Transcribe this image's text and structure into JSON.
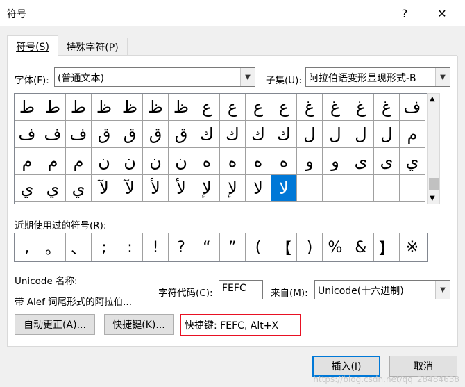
{
  "window": {
    "title": "符号",
    "help_label": "?",
    "close_label": "✕"
  },
  "tabs": [
    {
      "label": "符号(S)"
    },
    {
      "label": "特殊字符(P)"
    }
  ],
  "font": {
    "label": "字体(F):",
    "value": "(普通文本)"
  },
  "subset": {
    "label": "子集(U):",
    "value": "阿拉伯语变形显现形式-B"
  },
  "symbols": [
    [
      "ط",
      "ط",
      "ط",
      "ظ",
      "ظ",
      "ظ",
      "ظ",
      "ع",
      "ع",
      "ع",
      "ع",
      "غ",
      "غ",
      "غ",
      "غ",
      "ف"
    ],
    [
      "ف",
      "ف",
      "ف",
      "ق",
      "ق",
      "ق",
      "ق",
      "ك",
      "ك",
      "ك",
      "ك",
      "ل",
      "ل",
      "ل",
      "ل",
      "م"
    ],
    [
      "م",
      "م",
      "م",
      "ن",
      "ن",
      "ن",
      "ن",
      "ه",
      "ه",
      "ه",
      "ه",
      "و",
      "و",
      "ى",
      "ى",
      "ي"
    ],
    [
      "ي",
      "ي",
      "ي",
      "لآ",
      "لآ",
      "لأ",
      "لأ",
      "لإ",
      "لإ",
      "لا",
      "لا",
      "",
      "",
      "",
      "",
      ""
    ]
  ],
  "selected_index": {
    "row": 3,
    "col": 10
  },
  "recent": {
    "label": "近期使用过的符号(R):",
    "items": [
      ",",
      "。",
      "、",
      ";",
      ":",
      "!",
      "?",
      "“",
      "”",
      "(",
      "【",
      ")",
      "%",
      "&",
      "】",
      "※"
    ]
  },
  "unicode_name": {
    "label": "Unicode 名称:",
    "value": "带 Alef 词尾形式的阿拉伯..."
  },
  "char_code": {
    "label": "字符代码(C):",
    "value": "FEFC"
  },
  "from": {
    "label": "来自(M):",
    "value": "Unicode(十六进制)"
  },
  "buttons": {
    "autocorrect": "自动更正(A)...",
    "shortcut_key": "快捷键(K)...",
    "insert": "插入(I)",
    "cancel": "取消"
  },
  "shortcut_text": "快捷键: FEFC, Alt+X",
  "watermark": "https://blog.csdn.net/qq_28484638",
  "colors": {
    "selection": "#0078d7",
    "shortcut_border": "#e81123"
  }
}
